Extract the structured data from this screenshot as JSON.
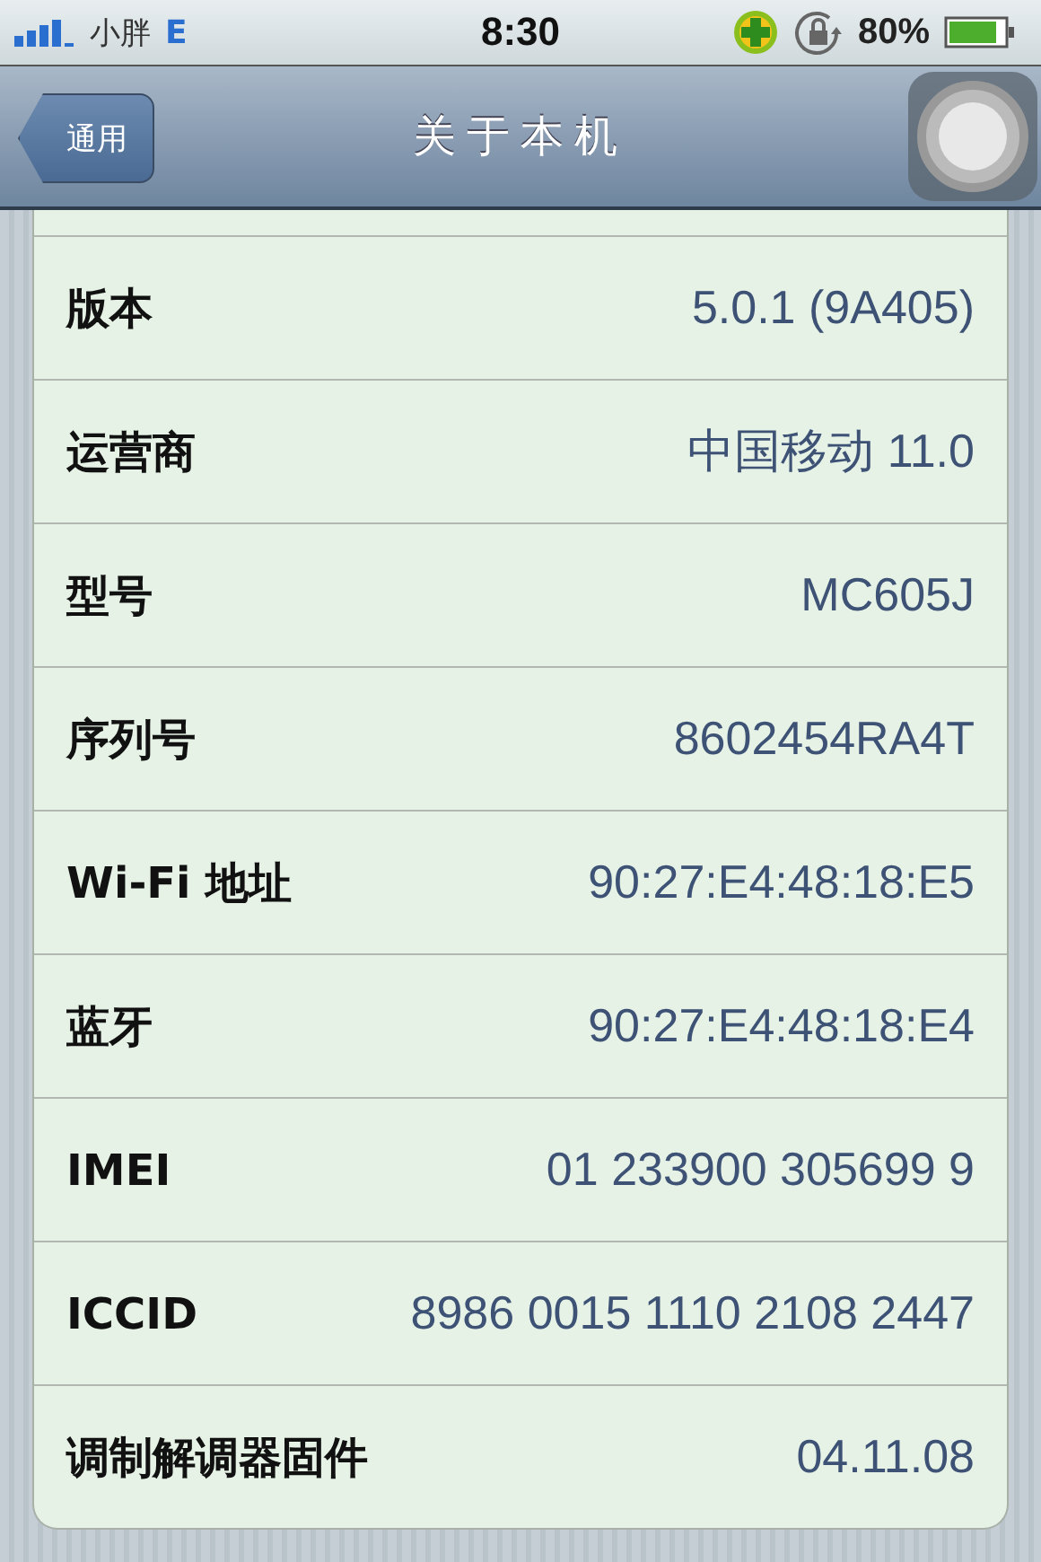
{
  "status_bar": {
    "carrier": "小胖",
    "network": "E",
    "time": "8:30",
    "battery": "80%"
  },
  "nav_bar": {
    "back": "通用",
    "title": "关于本机"
  },
  "rows": [
    {
      "label": "版本",
      "value": "5.0.1 (9A405)"
    },
    {
      "label": "运营商",
      "value": "中国移动 11.0"
    },
    {
      "label": "型号",
      "value": "MC605J"
    },
    {
      "label": "序列号",
      "value": "8602454RA4T"
    },
    {
      "label": "Wi-Fi 地址",
      "value": "90:27:E4:48:18:E5"
    },
    {
      "label": "蓝牙",
      "value": "90:27:E4:48:18:E4"
    },
    {
      "label": "IMEI",
      "value": "01 233900 305699 9"
    },
    {
      "label": "ICCID",
      "value": "8986 0015 1110 2108 2447"
    },
    {
      "label": "调制解调器固件",
      "value": "04.11.08"
    }
  ]
}
